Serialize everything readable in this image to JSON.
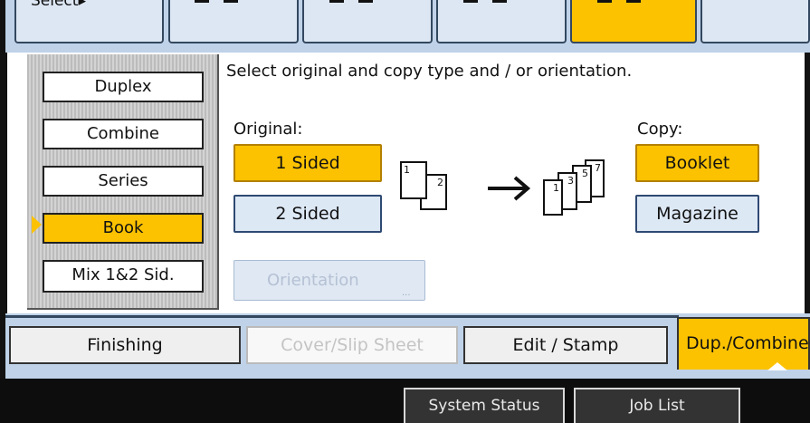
{
  "top_strip": {
    "select_label": "Select▸"
  },
  "sidebar": {
    "items": [
      {
        "label": "Duplex"
      },
      {
        "label": "Combine"
      },
      {
        "label": "Series"
      },
      {
        "label": "Book"
      },
      {
        "label": "Mix 1&2 Sid."
      }
    ],
    "selected": "Book"
  },
  "main": {
    "instruction": "Select original and copy type and / or orientation.",
    "original_label": "Original:",
    "copy_label": "Copy:",
    "original_options": [
      "1 Sided",
      "2 Sided"
    ],
    "original_selected": "1 Sided",
    "copy_options": [
      "Booklet",
      "Magazine"
    ],
    "copy_selected": "Booklet",
    "orientation_label": "Orientation",
    "orientation_dots": "...",
    "original_sheet_numbers": [
      "1",
      "2"
    ],
    "copy_sheet_numbers": [
      "1",
      "3",
      "5",
      "7"
    ]
  },
  "tabs": {
    "finishing": "Finishing",
    "cover_slip": "Cover/Slip Sheet",
    "edit_stamp": "Edit / Stamp",
    "dup_combine": "Dup./Combine"
  },
  "footer": {
    "system_status": "System Status",
    "job_list": "Job List"
  },
  "colors": {
    "selected": "#fcc200",
    "panel_bg": "#bfd2e8",
    "button_bg": "#dde8f5"
  }
}
